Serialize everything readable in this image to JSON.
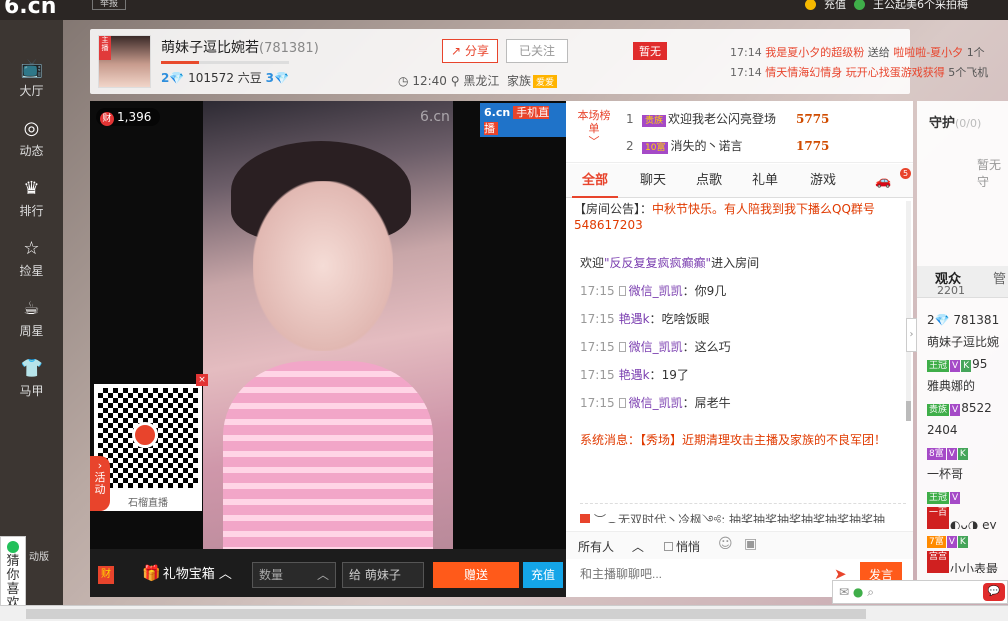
{
  "topbar": {
    "logo": "6.cn",
    "btn": "举报",
    "recharge": "充值",
    "user": "王公起美6个采拍梅"
  },
  "nav": [
    {
      "label": "大厅",
      "icon": "tv-icon"
    },
    {
      "label": "动态",
      "icon": "compass-icon"
    },
    {
      "label": "排行",
      "icon": "crown-icon"
    },
    {
      "label": "捡星",
      "icon": "star-icon"
    },
    {
      "label": "周星",
      "icon": "cup-icon"
    },
    {
      "label": "马甲",
      "icon": "shirt-icon"
    }
  ],
  "guess": "猜你喜欢",
  "dongtai": "动版",
  "anchor": {
    "name": "萌妹子逗比婉若",
    "room_id": "(781381)",
    "beans": "101572 六豆",
    "level1": "2",
    "level2": "3",
    "progress_pct": 30,
    "time": "12:40",
    "location": "黑龙江",
    "family": "家族",
    "family_badge": "爱爱",
    "share": "分享",
    "follow": "已关注",
    "zanwu": "暂无"
  },
  "marquee": [
    {
      "time": "17:14",
      "a": "我是夏小夕的超级粉",
      "verb": "送给",
      "b": "啦啦啦-夏小夕",
      "tail": "1个"
    },
    {
      "time": "17:14",
      "a": "情天情海幻情身 玩开心找蛋游戏获得",
      "tail": "5个飞机"
    }
  ],
  "video": {
    "viewers": "1,396",
    "cai": "财",
    "logo": "6.cn",
    "logo_tag": "手机直播",
    "watermark": "6.cn"
  },
  "qr": {
    "caption": "石榴直播",
    "close": "×"
  },
  "huodong": "活动",
  "giftbar": {
    "cai": "财",
    "giftbox": "礼物宝箱",
    "qty_placeholder": "数量",
    "to": "给  萌妹子",
    "send": "赠送",
    "recharge": "充值"
  },
  "rank": {
    "title": "本场榜单",
    "rows": [
      {
        "num": "1",
        "badge": "贵族",
        "name": "欢迎我老公闪亮登场",
        "coin": "5775"
      },
      {
        "num": "2",
        "badge": "10富",
        "name": "消失的丶诺言",
        "coin": "1775"
      }
    ]
  },
  "tabs": [
    "全部",
    "聊天",
    "点歌",
    "礼单",
    "游戏"
  ],
  "car_count": "5",
  "notice": {
    "label": "【房间公告】：",
    "text": "中秋节快乐。有人陪我到我下播么QQ群号548617203"
  },
  "welcome": {
    "pre": "欢迎",
    "user": "\"反反复复疯疯癫癫\"",
    "post": "进入房间"
  },
  "messages": [
    {
      "time": "17:15",
      "user": "微信_凯凯",
      "text": "你9几",
      "phone": true
    },
    {
      "time": "17:15",
      "user": "艳遇k",
      "text": "吃啥饭眼",
      "phone": false
    },
    {
      "time": "17:15",
      "user": "微信_凯凯",
      "text": "这么巧",
      "phone": true
    },
    {
      "time": "17:15",
      "user": "艳遇k",
      "text": "19了",
      "phone": false
    },
    {
      "time": "17:15",
      "user": "微信_凯凯",
      "text": "屌老牛",
      "phone": true
    }
  ],
  "system": {
    "label": "系统消息：",
    "text": "【秀场】近期清理攻击主播及家族的不良军团！"
  },
  "lotto": "︶︵无双时代丶冷枫༺: 抽奖抽奖抽奖抽奖抽奖抽奖抽",
  "chat_ctrl": {
    "target": "所有人",
    "quiet": "悄悄"
  },
  "chat_input_placeholder": "和主播聊聊吧...",
  "chat_send": "发言",
  "guard": {
    "title": "守护",
    "count": "(0/0)",
    "empty": "暂无守"
  },
  "audience": {
    "tab": "观众",
    "count": "2201",
    "tab2": "管"
  },
  "audience_list": [
    {
      "badges": [],
      "text": "2💎 781381"
    },
    {
      "badges": [],
      "text": "萌妹子逗比婉"
    },
    {
      "badges": [
        "王冠",
        "V",
        "K"
      ],
      "text": "95"
    },
    {
      "badges": [],
      "text": "雅典娜的"
    },
    {
      "badges": [
        "贵族",
        "V"
      ],
      "text": "8522"
    },
    {
      "badges": [],
      "text": "2404"
    },
    {
      "badges": [
        "8富",
        "V",
        "K"
      ],
      "text": ""
    },
    {
      "badges": [],
      "text": "一杯哥"
    },
    {
      "badges": [
        "王冠",
        "V"
      ],
      "text": ""
    },
    {
      "badges": [
        "一百"
      ],
      "text": "◐ᴗ◑ ey"
    },
    {
      "badges": [
        "7富",
        "V",
        "K"
      ],
      "text": ""
    },
    {
      "badges": [
        "宫宫"
      ],
      "text": "小小表最"
    }
  ]
}
